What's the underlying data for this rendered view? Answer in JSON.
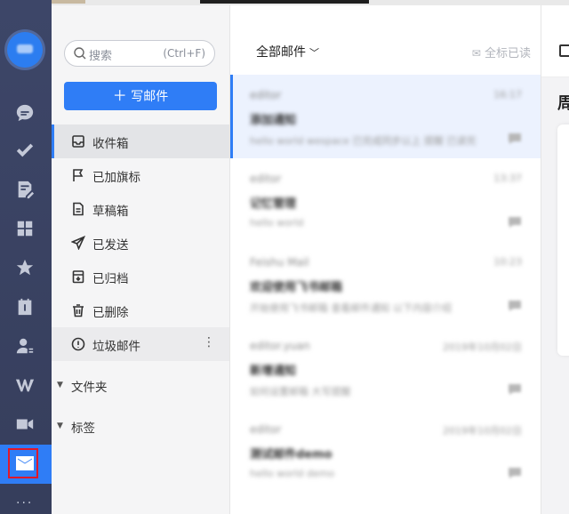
{
  "search": {
    "placeholder": "搜索",
    "shortcut": "(Ctrl+F)"
  },
  "compose": {
    "label": "写邮件"
  },
  "folders": [
    {
      "label": "收件箱",
      "icon": "inbox-icon"
    },
    {
      "label": "已加旗标",
      "icon": "flag-icon"
    },
    {
      "label": "草稿箱",
      "icon": "draft-icon"
    },
    {
      "label": "已发送",
      "icon": "send-icon"
    },
    {
      "label": "已归档",
      "icon": "archive-icon"
    },
    {
      "label": "已删除",
      "icon": "trash-icon"
    },
    {
      "label": "垃圾邮件",
      "icon": "spam-icon"
    }
  ],
  "groups": {
    "folder": "文件夹",
    "tags": "标签"
  },
  "list": {
    "filter": "全部邮件",
    "mark_all_read": "全标已读",
    "items": [
      {
        "sender": "editor",
        "date": "16:17",
        "subject": "添加通知",
        "preview": "hello world wespace 已完成同步以上 提醒 已读完"
      },
      {
        "sender": "editor",
        "date": "13:37",
        "subject": "记忆管理",
        "preview": "hello world"
      },
      {
        "sender": "Feishu Mail",
        "date": "10:23",
        "subject": "欢迎使用飞书邮箱",
        "preview": "开始使用飞书邮箱 查看邮件通知 以下内容介绍"
      },
      {
        "sender": "editor.yuan",
        "date": "2019年10月02日",
        "subject": "新增通知",
        "preview": "如何设置邮箱 大写提醒"
      },
      {
        "sender": "editor",
        "date": "2019年10月02日",
        "subject": "测试邮件demo",
        "preview": "hello world demo"
      }
    ]
  },
  "reader": {
    "heading_char": "周"
  },
  "more": "···"
}
